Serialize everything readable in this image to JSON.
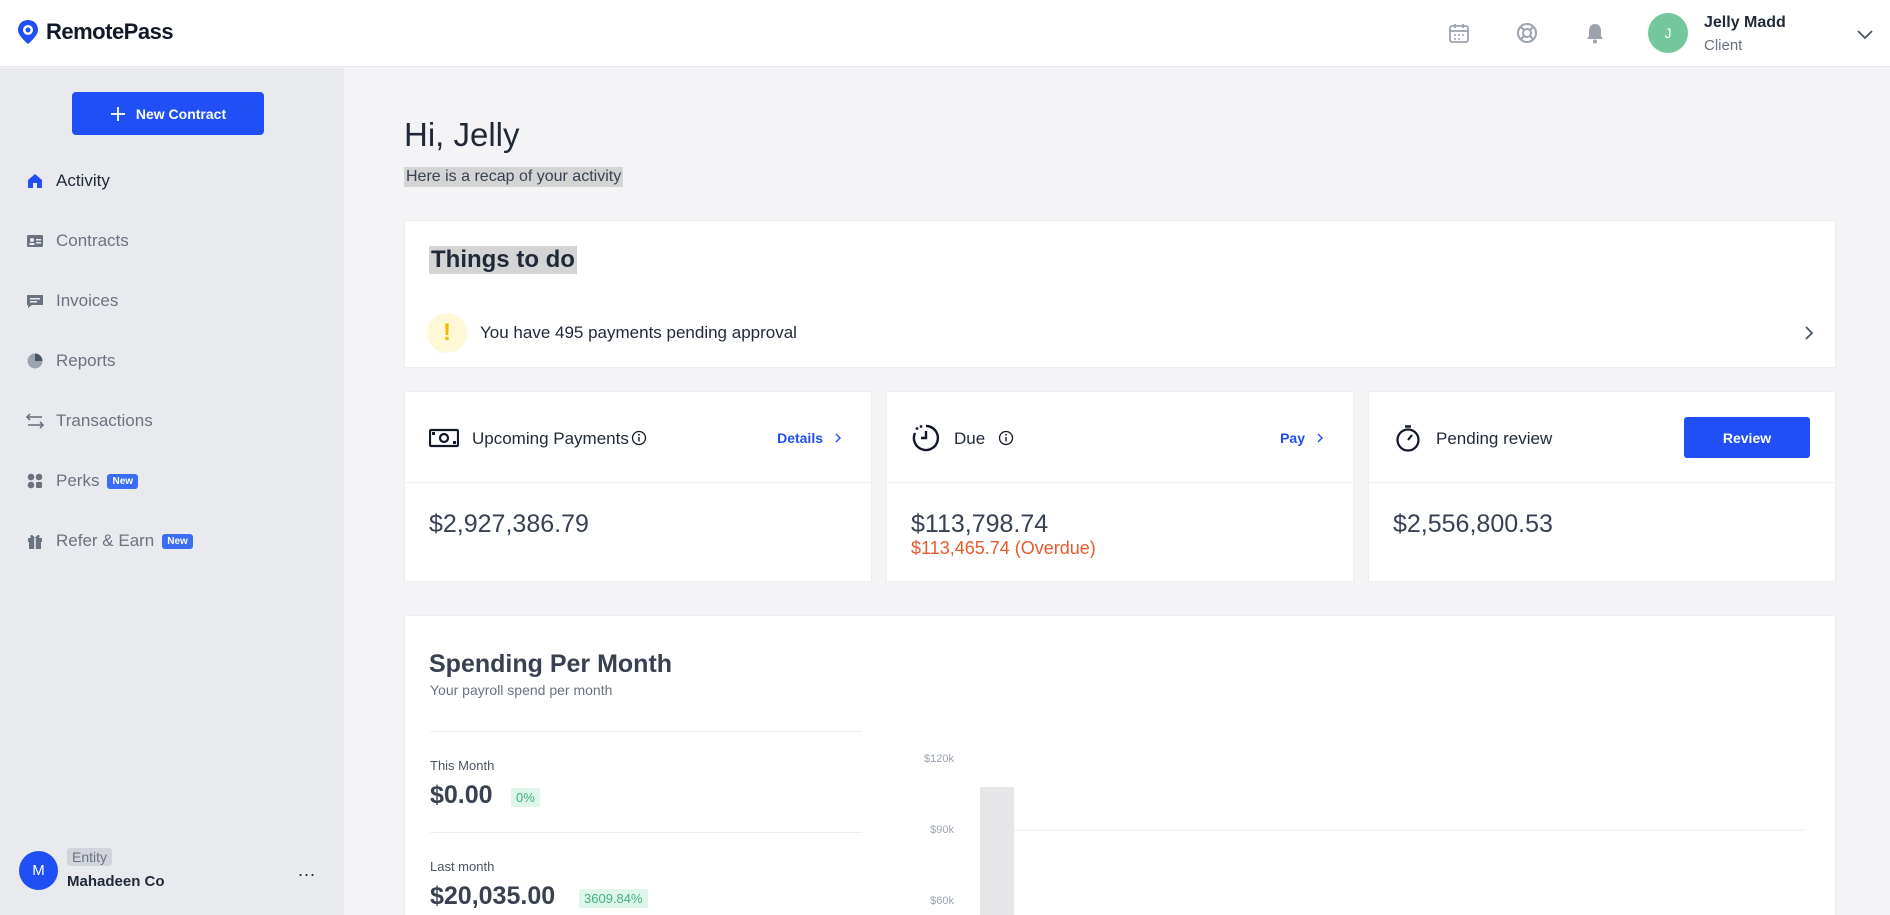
{
  "app": {
    "name": "RemotePass"
  },
  "header": {
    "icons": [
      "calendar-icon",
      "support-icon",
      "bell-icon"
    ],
    "user": {
      "initial": "J",
      "name": "Jelly Madd",
      "role": "Client"
    }
  },
  "sidebar": {
    "new_contract_label": "New Contract",
    "items": [
      {
        "label": "Activity",
        "icon": "home-icon",
        "active": true
      },
      {
        "label": "Contracts",
        "icon": "contracts-icon"
      },
      {
        "label": "Invoices",
        "icon": "invoices-icon"
      },
      {
        "label": "Reports",
        "icon": "reports-icon"
      },
      {
        "label": "Transactions",
        "icon": "transactions-icon"
      },
      {
        "label": "Perks",
        "icon": "perks-icon",
        "badge": "New"
      },
      {
        "label": "Refer & Earn",
        "icon": "gift-icon",
        "badge": "New"
      }
    ],
    "entity": {
      "initial": "M",
      "tag": "Entity",
      "name": "Mahadeen Co",
      "more": "..."
    }
  },
  "main": {
    "greeting": "Hi, Jelly",
    "recap": "Here is a recap of your activity",
    "todo": {
      "title": "Things to do",
      "items": [
        {
          "text": "You have 495 payments pending approval"
        }
      ]
    },
    "stats": [
      {
        "label": "Upcoming Payments",
        "link": "Details",
        "value": "$2,927,386.79"
      },
      {
        "label": "Due",
        "link": "Pay",
        "value": "$113,798.74",
        "overdue": "$113,465.74 (Overdue)"
      },
      {
        "label": "Pending review",
        "button": "Review",
        "value": "$2,556,800.53"
      }
    ],
    "spending": {
      "title": "Spending Per Month",
      "subtitle": "Your payroll spend per month",
      "this_month": {
        "label": "This Month",
        "value": "$0.00",
        "change": "0%"
      },
      "last_month": {
        "label": "Last month",
        "value": "$20,035.00",
        "change": "3609.84%"
      }
    }
  },
  "chart_data": {
    "type": "bar",
    "y_ticks": [
      "$120k",
      "$90k",
      "$60k"
    ],
    "ylim": [
      60000,
      120000
    ],
    "partial_bar_visible": true
  },
  "colors": {
    "primary": "#1f4ff5",
    "overdue": "#ea5a2b",
    "positive": "#3fb27f"
  }
}
